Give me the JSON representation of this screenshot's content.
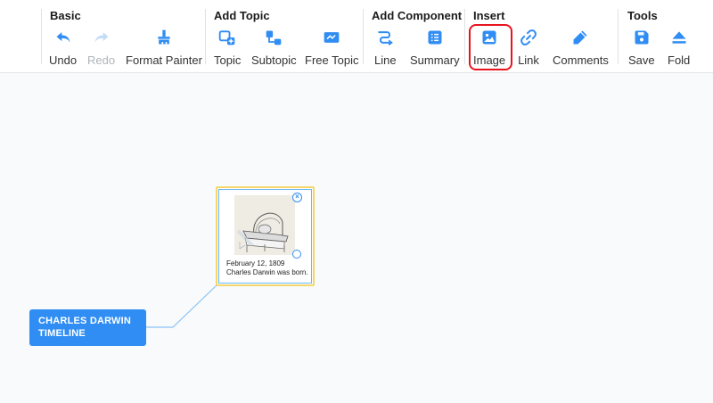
{
  "toolbar": {
    "groups": [
      {
        "title": "Basic",
        "tools": [
          {
            "label": "Undo",
            "icon": "undo-icon"
          },
          {
            "label": "Redo",
            "icon": "redo-icon",
            "disabled": true
          },
          {
            "label": "Format Painter",
            "icon": "format-painter-icon"
          }
        ]
      },
      {
        "title": "Add Topic",
        "tools": [
          {
            "label": "Topic",
            "icon": "add-topic-icon"
          },
          {
            "label": "Subtopic",
            "icon": "subtopic-icon"
          },
          {
            "label": "Free Topic",
            "icon": "free-topic-icon"
          }
        ]
      },
      {
        "title": "Add Component",
        "tools": [
          {
            "label": "Line",
            "icon": "line-icon"
          },
          {
            "label": "Summary",
            "icon": "summary-icon"
          }
        ]
      },
      {
        "title": "Insert",
        "tools": [
          {
            "label": "Image",
            "icon": "image-icon",
            "highlighted": true
          },
          {
            "label": "Link",
            "icon": "link-icon"
          },
          {
            "label": "Comments",
            "icon": "comments-icon"
          }
        ]
      },
      {
        "title": "Tools",
        "tools": [
          {
            "label": "Save",
            "icon": "save-icon"
          },
          {
            "label": "Fold",
            "icon": "fold-icon"
          }
        ]
      }
    ]
  },
  "mindmap": {
    "root": {
      "text_line1": "CHARLES DARWIN",
      "text_line2": "TIMELINE"
    },
    "topic": {
      "date": "February 12, 1809",
      "caption": "Charles Darwin was born.",
      "close_glyph": "×"
    }
  },
  "colors": {
    "accent": "#2f8df3",
    "highlight": "#e8131e",
    "selection": "#f5d66a"
  }
}
